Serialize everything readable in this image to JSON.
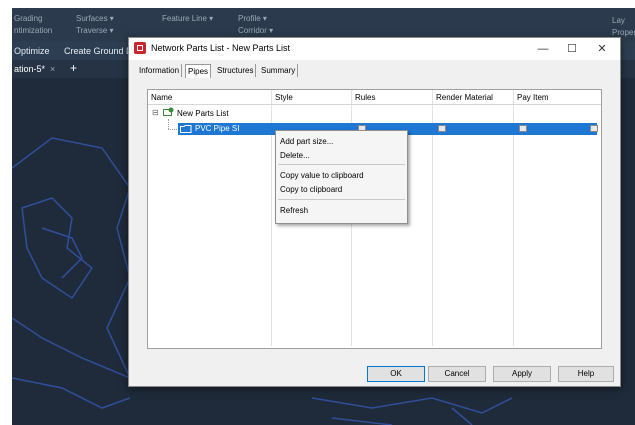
{
  "app": {
    "ribbon": {
      "grading_label": "Grading",
      "grading_sub": "ntimization",
      "surfaces_label": "Surfaces ▾",
      "traverse_label": "Traverse ▾",
      "feature_line_label": "Feature Line ▾",
      "profile_label": "Profile ▾",
      "corridor_label": "Corridor ▾",
      "layers_label": "Lay",
      "properties_label": "Proper"
    },
    "command_bar": {
      "optimize_label": "Optimize",
      "create_ground_label": "Create Ground D"
    },
    "doc_tab": {
      "label": "ation-5*",
      "close_glyph": "×",
      "add_glyph": "+"
    },
    "colors": {
      "canvas": "#1f2b3a",
      "linework": "#2f4f9a",
      "selection": "#1f77d4"
    }
  },
  "dialog": {
    "title": "Network Parts List - New Parts List",
    "window_buttons": {
      "minimize": "—",
      "maximize": "☐",
      "close": "✕"
    },
    "tabs": [
      {
        "label": "Information",
        "active": false
      },
      {
        "label": "Pipes",
        "active": true
      },
      {
        "label": "Structures",
        "active": false
      },
      {
        "label": "Summary",
        "active": false
      }
    ],
    "columns": [
      "Name",
      "Style",
      "Rules",
      "Render Material",
      "Pay Item"
    ],
    "tree": {
      "root_label": "New Parts List",
      "child_label": "PVC Pipe SI"
    },
    "context_menu": {
      "items": [
        "Add part size...",
        "Delete...",
        "Copy value to clipboard",
        "Copy to clipboard",
        "Refresh"
      ]
    },
    "buttons": {
      "ok": "OK",
      "cancel": "Cancel",
      "apply": "Apply",
      "help": "Help"
    }
  }
}
